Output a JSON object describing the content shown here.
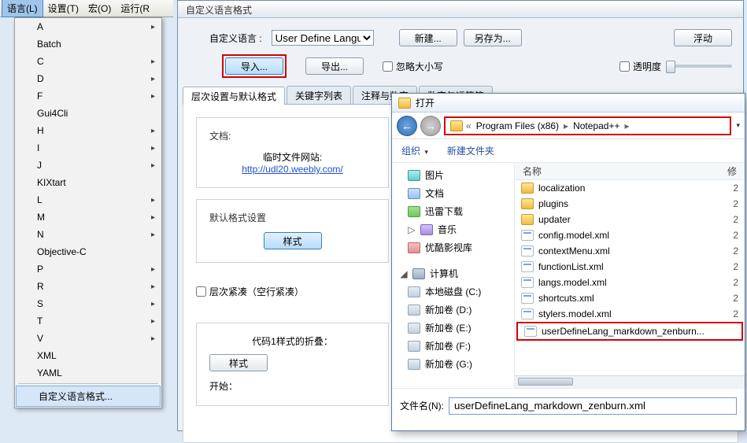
{
  "menubar": [
    "语言(L)",
    "设置(T)",
    "宏(O)",
    "运行(R"
  ],
  "languages": [
    "A",
    "Batch",
    "C",
    "D",
    "F",
    "Gui4Cli",
    "H",
    "I",
    "J",
    "KIXtart",
    "L",
    "M",
    "N",
    "Objective-C",
    "P",
    "R",
    "S",
    "T",
    "V",
    "XML",
    "YAML"
  ],
  "udl_menu_item": "自定义语言格式...",
  "udl": {
    "title": "自定义语言格式",
    "lang_label": "自定义语言 :",
    "lang_value": "User Define Language",
    "btn_new": "新建...",
    "btn_saveas": "另存为...",
    "btn_float": "浮动",
    "btn_import": "导入...",
    "btn_export": "导出...",
    "chk_ignorecase": "忽略大小写",
    "chk_transparent": "透明度",
    "tabs": [
      "层次设置与默认格式",
      "关键字列表",
      "注释与数字",
      "数字与运算符"
    ],
    "doc_label": "文档:",
    "tmpsite_label": "临时文件网站:",
    "tmpsite_url": "http://udl20.weebly.com/",
    "defstyle_label": "默认格式设置",
    "btn_style": "样式",
    "compress_label": "层次紧凑（空行紧凑）",
    "fold_label": "代码1样式的折叠：",
    "start_label": "开始："
  },
  "fileopen": {
    "title": "打开",
    "breadcrumb": [
      "Program Files (x86)",
      "Notepad++"
    ],
    "organize": "组织",
    "newfolder": "新建文件夹",
    "col_name": "名称",
    "col_mod": "修",
    "sidebar": [
      {
        "icon": "pic",
        "label": "图片",
        "exp": ""
      },
      {
        "icon": "doc",
        "label": "文档",
        "exp": ""
      },
      {
        "icon": "thunder",
        "label": "迅雷下载",
        "exp": ""
      },
      {
        "icon": "music",
        "label": "音乐",
        "exp": "▷"
      },
      {
        "icon": "video",
        "label": "优酷影视库",
        "exp": ""
      }
    ],
    "computer_label": "计算机",
    "drives": [
      {
        "icon": "drive",
        "label": "本地磁盘 (C:)"
      },
      {
        "icon": "drive",
        "label": "新加卷 (D:)"
      },
      {
        "icon": "drive",
        "label": "新加卷 (E:)"
      },
      {
        "icon": "drive",
        "label": "新加卷 (F:)"
      },
      {
        "icon": "drive",
        "label": "新加卷 (G:)"
      }
    ],
    "files": [
      {
        "icon": "folder",
        "name": "localization",
        "d": "2"
      },
      {
        "icon": "folder",
        "name": "plugins",
        "d": "2"
      },
      {
        "icon": "folder",
        "name": "updater",
        "d": "2"
      },
      {
        "icon": "xml",
        "name": "config.model.xml",
        "d": "2"
      },
      {
        "icon": "xml",
        "name": "contextMenu.xml",
        "d": "2"
      },
      {
        "icon": "xml",
        "name": "functionList.xml",
        "d": "2"
      },
      {
        "icon": "xml",
        "name": "langs.model.xml",
        "d": "2"
      },
      {
        "icon": "xml",
        "name": "shortcuts.xml",
        "d": "2"
      },
      {
        "icon": "xml",
        "name": "stylers.model.xml",
        "d": "2"
      },
      {
        "icon": "xml",
        "name": "userDefineLang_markdown_zenburn...",
        "d": "",
        "hl": true
      }
    ],
    "filename_label": "文件名(N):",
    "filename_value": "userDefineLang_markdown_zenburn.xml"
  }
}
